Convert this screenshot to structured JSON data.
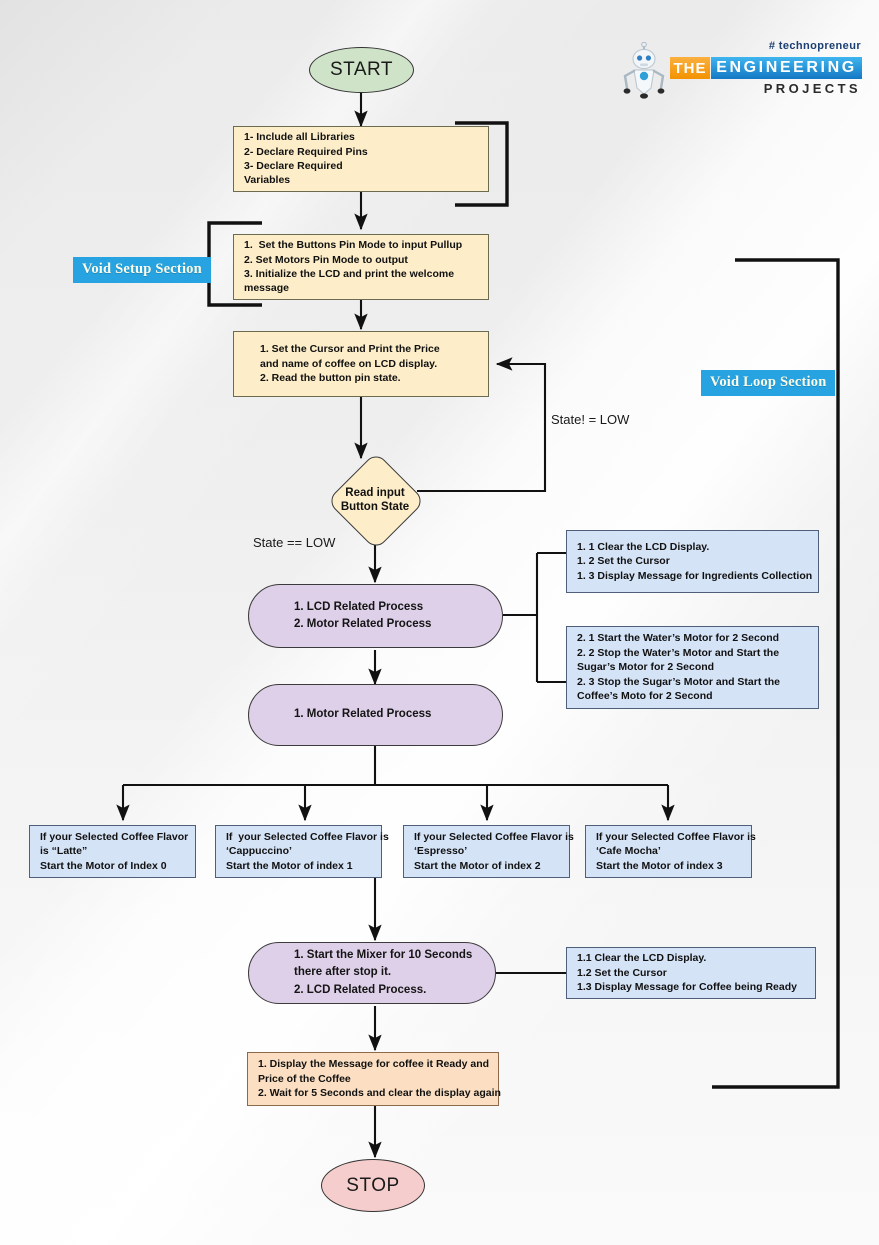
{
  "logo": {
    "tagline": "# technopreneur",
    "the": "THE",
    "engineering": "ENGINEERING",
    "projects": "PROJECTS",
    "robot_icon": "robot-mascot-icon",
    "colors": {
      "orange": "#f39200",
      "blue": "#1478c4",
      "tagline_blue": "#1b3f73"
    }
  },
  "badges": {
    "setup": "Void Setup Section",
    "loop": "Void Loop Section",
    "color": "#26a3e0"
  },
  "terminals": {
    "start": "START",
    "stop": "STOP",
    "start_color": "#cfe3c8",
    "stop_color": "#f6cdcd"
  },
  "edge_labels": {
    "state_not_low": "State! = LOW",
    "state_low": "State == LOW"
  },
  "decision": {
    "line1": "Read input",
    "line2": "Button State",
    "color": "#fdeec9"
  },
  "nodes": {
    "init": {
      "lines": [
        "1- Include all Libraries",
        "2- Declare Required Pins",
        "3- Declare Required",
        "Variables"
      ],
      "color": "#fdeec9"
    },
    "setup": {
      "lines": [
        "1.  Set the Buttons Pin Mode to input Pullup",
        "2. Set Motors Pin Mode to output",
        "3. Initialize the LCD and print the welcome",
        "message"
      ],
      "color": "#fdeec9"
    },
    "display_price": {
      "lines": [
        "1. Set the Cursor and Print the Price",
        "and name of coffee on LCD display.",
        "2. Read the button pin state."
      ],
      "color": "#fdeec9"
    },
    "lcd_motor_process": {
      "lines": [
        "1. LCD Related Process",
        "2. Motor Related Process"
      ],
      "color": "#ded0e8"
    },
    "motor_process": {
      "lines": [
        "1. Motor Related Process"
      ],
      "color": "#ded0e8"
    },
    "mixer": {
      "lines": [
        "1. Start the Mixer for 10 Seconds",
        "there after stop it.",
        "2. LCD Related Process."
      ],
      "color": "#ded0e8"
    },
    "final_message": {
      "lines": [
        "1. Display the Message for coffee it Ready and",
        "Price of the Coffee",
        "2. Wait for 5 Seconds and clear the display again"
      ],
      "color": "#fcdfc2"
    }
  },
  "detail_boxes": {
    "lcd_detail": {
      "lines": [
        "1. 1 Clear the LCD Display.",
        "1. 2 Set the Cursor",
        "1. 3 Display Message for Ingredients Collection"
      ],
      "color": "#d5e3f7"
    },
    "motor_detail": {
      "lines": [
        "2. 1 Start the Water’s Motor for 2 Second",
        "2. 2 Stop the Water’s Motor and Start the",
        "Sugar’s Motor for 2 Second",
        "2. 3 Stop the Sugar’s Motor and Start the",
        "Coffee’s Moto for 2 Second"
      ],
      "color": "#d5e3f7"
    },
    "ready_detail": {
      "lines": [
        "1.1 Clear the LCD Display.",
        "1.2 Set the Cursor",
        "1.3 Display Message for Coffee being Ready"
      ],
      "color": "#d5e3f7"
    }
  },
  "flavor_branches": [
    {
      "lines": [
        "If your Selected Coffee Flavor",
        "is “Latte”",
        "Start the Motor of Index 0"
      ]
    },
    {
      "lines": [
        "If  your Selected Coffee Flavor is",
        "‘Cappuccino’",
        "Start the Motor of index 1"
      ]
    },
    {
      "lines": [
        "If your Selected Coffee Flavor is",
        "‘Espresso’",
        "Start the Motor of index 2"
      ]
    },
    {
      "lines": [
        "If your Selected Coffee Flavor is",
        "‘Cafe Mocha’",
        "Start the Motor of index 3"
      ]
    }
  ]
}
